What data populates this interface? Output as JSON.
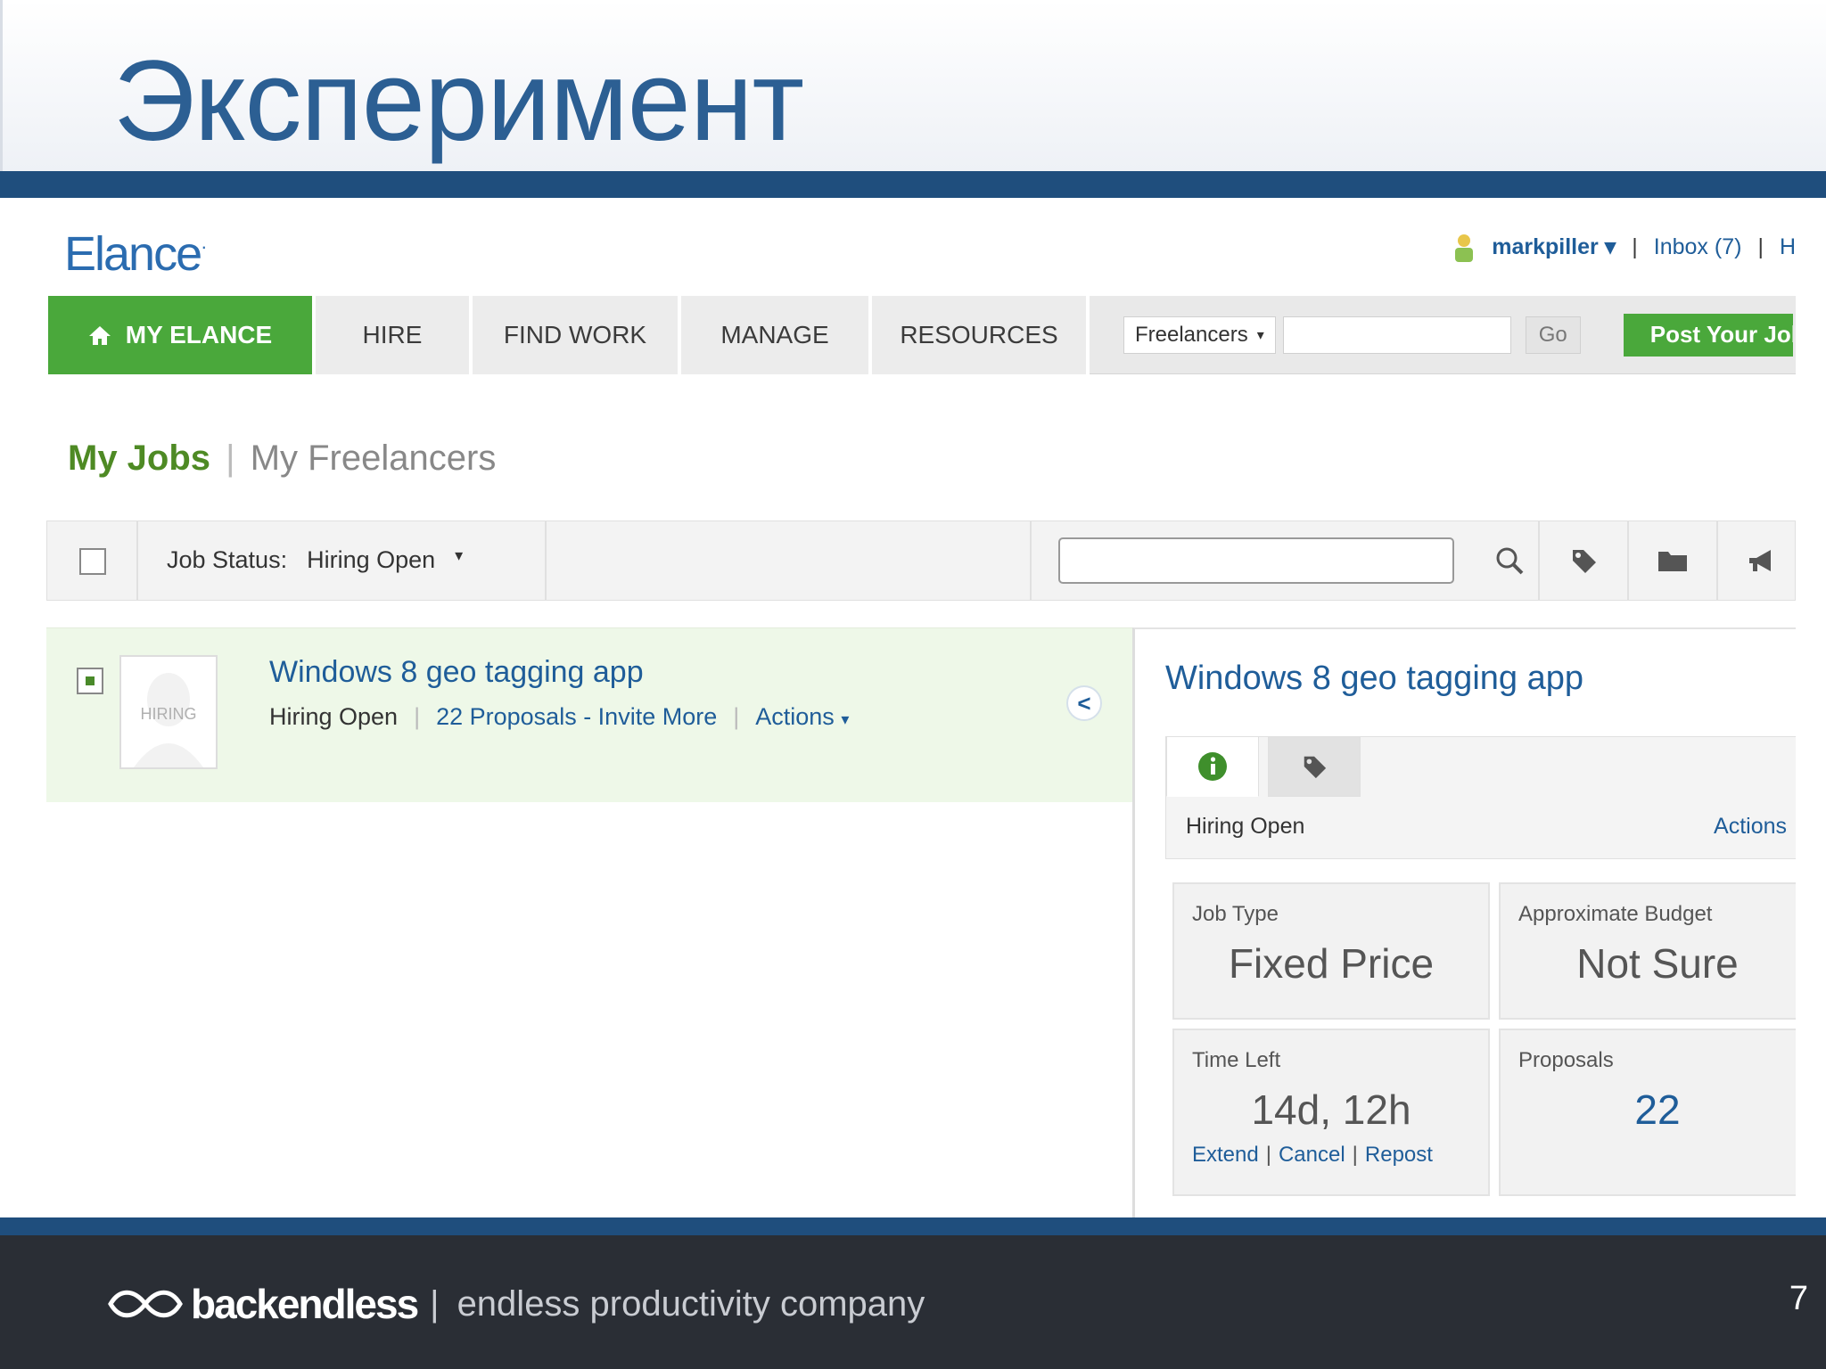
{
  "slide": {
    "title": "Эксперимент",
    "footer": {
      "brand": "backendless",
      "separator": "|",
      "tagline": "endless productivity company"
    },
    "page_number": "7"
  },
  "app": {
    "logo": "Elance",
    "logo_mark": "·",
    "user": {
      "name": "markpiller",
      "inbox": "Inbox (7)",
      "separator": "|",
      "next_item": "H"
    },
    "nav": {
      "items": [
        {
          "label": "MY ELANCE"
        },
        {
          "label": "HIRE"
        },
        {
          "label": "FIND WORK"
        },
        {
          "label": "MANAGE"
        },
        {
          "label": "RESOURCES"
        }
      ],
      "search_category": "Freelancers",
      "search_value": "",
      "go_label": "Go",
      "post_label": "Post Your Job"
    },
    "subnav": {
      "my_jobs": "My Jobs",
      "separator": "|",
      "my_freelancers": "My Freelancers"
    },
    "toolbar": {
      "status_label": "Job Status:",
      "status_value": "Hiring Open",
      "search_value": ""
    },
    "job": {
      "thumb_label": "HIRING",
      "title": "Windows 8 geo tagging app",
      "status": "Hiring Open",
      "proposals_link": "22 Proposals - Invite More",
      "actions": "Actions",
      "separator": "|"
    },
    "panel": {
      "title": "Windows 8 geo tagging app",
      "status": "Hiring Open",
      "actions": "Actions",
      "cards": {
        "job_type": {
          "label": "Job Type",
          "value": "Fixed Price"
        },
        "budget": {
          "label": "Approximate Budget",
          "value": "Not Sure"
        },
        "time_left": {
          "label": "Time Left",
          "value": "14d, 12h",
          "links": [
            "Extend",
            "Cancel",
            "Repost"
          ]
        },
        "proposals": {
          "label": "Proposals",
          "value": "22"
        }
      }
    }
  },
  "colors": {
    "slide_title": "#2c5f93",
    "rule": "#1f4e7d",
    "footer_bg": "#2a2e35",
    "elance_green": "#4aa83b",
    "link_blue": "#1f5d99",
    "row_highlight": "#eef8e8"
  },
  "icons": [
    "home-icon",
    "user-icon",
    "caret-down-icon",
    "search-icon",
    "tag-icon",
    "folder-icon",
    "megaphone-icon",
    "info-icon",
    "collapse-left-icon"
  ]
}
